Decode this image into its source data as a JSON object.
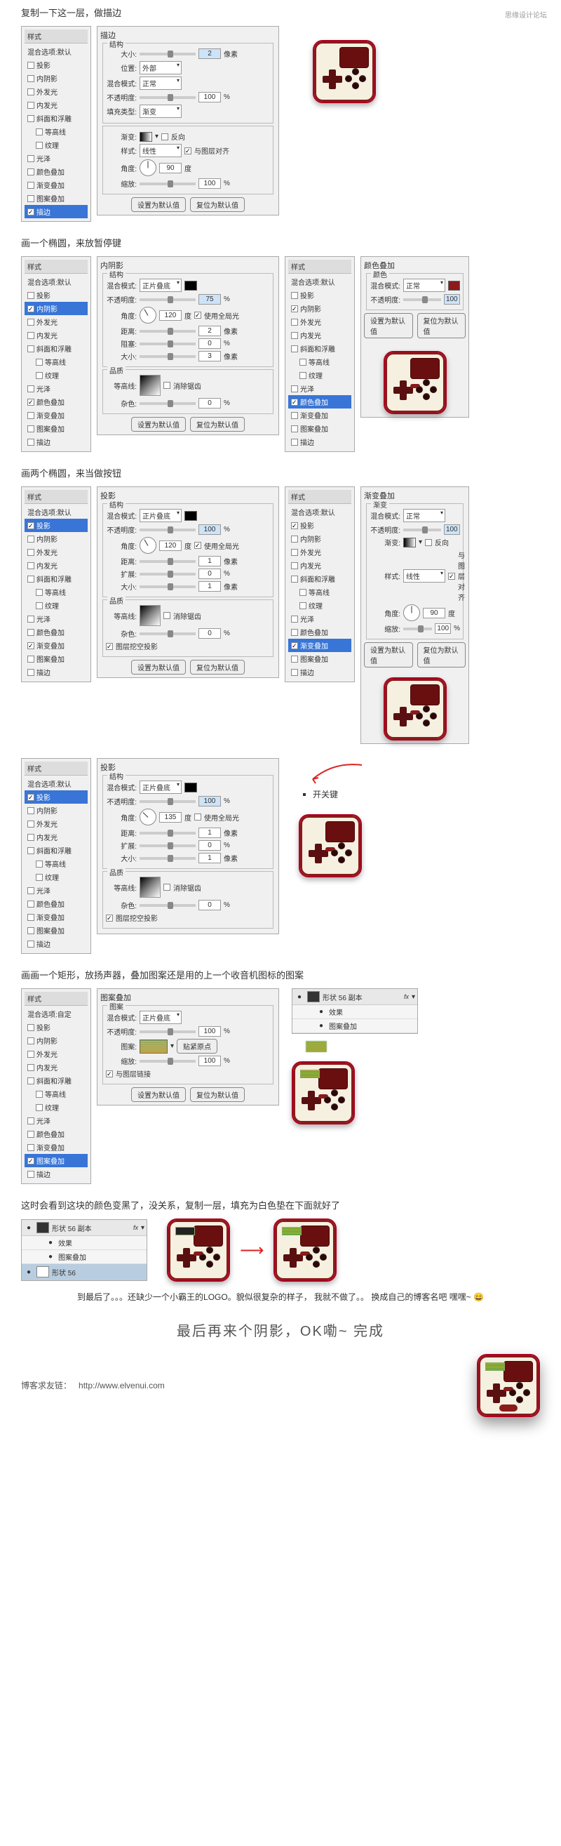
{
  "watermark": "思缘设计论坛",
  "steps": {
    "s1": {
      "title": "复制一下这一层，做描边"
    },
    "s2": {
      "title": "画一个椭圆，来放暂停键"
    },
    "s3": {
      "title": "画两个椭圆，来当做按钮"
    },
    "s4": {
      "switch_label": "开关键"
    },
    "s5": {
      "title": "画画一个矩形，放扬声器，叠加图案还是用的上一个收音机图标的图案"
    },
    "s6": {
      "title": "这时会看到这块的颜色变黑了，没关系，复制一层，填充为白色垫在下面就好了"
    },
    "note": "到最后了。。。还缺少一个小霸王的LOGO。貌似很复杂的样子，\n我就不做了。。  换成自己的博客名吧   嘿嘿~  😄",
    "final": "最后再来个阴影，OK嘞~   完成",
    "link_label": "博客求友链：",
    "link_url": "http://www.elvenui.com"
  },
  "style_panel": {
    "header": "样式",
    "blending_header": "混合选项:默认",
    "blending_custom": "混合选项:自定",
    "items": [
      "投影",
      "内阴影",
      "外发光",
      "内发光",
      "斜面和浮雕",
      "等高线",
      "纹理",
      "光泽",
      "颜色叠加",
      "渐变叠加",
      "图案叠加",
      "描边"
    ]
  },
  "labels": {
    "structure": "结构",
    "quality": "品质",
    "gradient_section": "渐变",
    "pattern_section": "图案",
    "blend_mode": "混合模式:",
    "opacity": "不透明度:",
    "position": "位置:",
    "fill_type": "填充类型:",
    "gradient": "渐变:",
    "style": "样式:",
    "angle": "角度:",
    "scale": "缩放:",
    "distance": "距离:",
    "spread": "扩展:",
    "choke": "阻塞:",
    "size": "大小:",
    "contour": "等高线:",
    "noise": "杂色:",
    "color": "颜色",
    "pattern": "图案:",
    "color_overlay_head": "颜色叠加",
    "grad_overlay_head": "渐变叠加",
    "pattern_overlay_head": "图案叠加",
    "drop_shadow_head": "投影",
    "inner_shadow_head": "内阴影",
    "stroke_head": "描边",
    "snap_origin": "贴紧原点"
  },
  "values": {
    "px_unit": "像素",
    "deg_unit": "度",
    "pct_unit": "%",
    "multiply": "正片叠底",
    "normal": "正常",
    "linear": "线性",
    "outside": "外部",
    "gradient_fill": "渐变",
    "reverse": "反向",
    "align_layer": "与图层对齐",
    "link_layer": "与图层链接",
    "use_global": "使用全局光",
    "anti_alias": "消除锯齿",
    "knockout": "图层挖空投影",
    "set_default": "设置为默认值",
    "reset_default": "复位为默认值",
    "size2": "2",
    "size3": "3",
    "op75": "75",
    "op100": "100",
    "ang90": "90",
    "ang120": "120",
    "ang135": "135",
    "dist2": "2",
    "dist1": "1",
    "choke0": "0",
    "noise0": "0"
  },
  "layers": {
    "shape_label": "形状 56 副本",
    "shape_orig": "形状 56",
    "fx": "fx",
    "effects": "效果",
    "pattern_overlay": "图案叠加",
    "eye": "👁"
  }
}
